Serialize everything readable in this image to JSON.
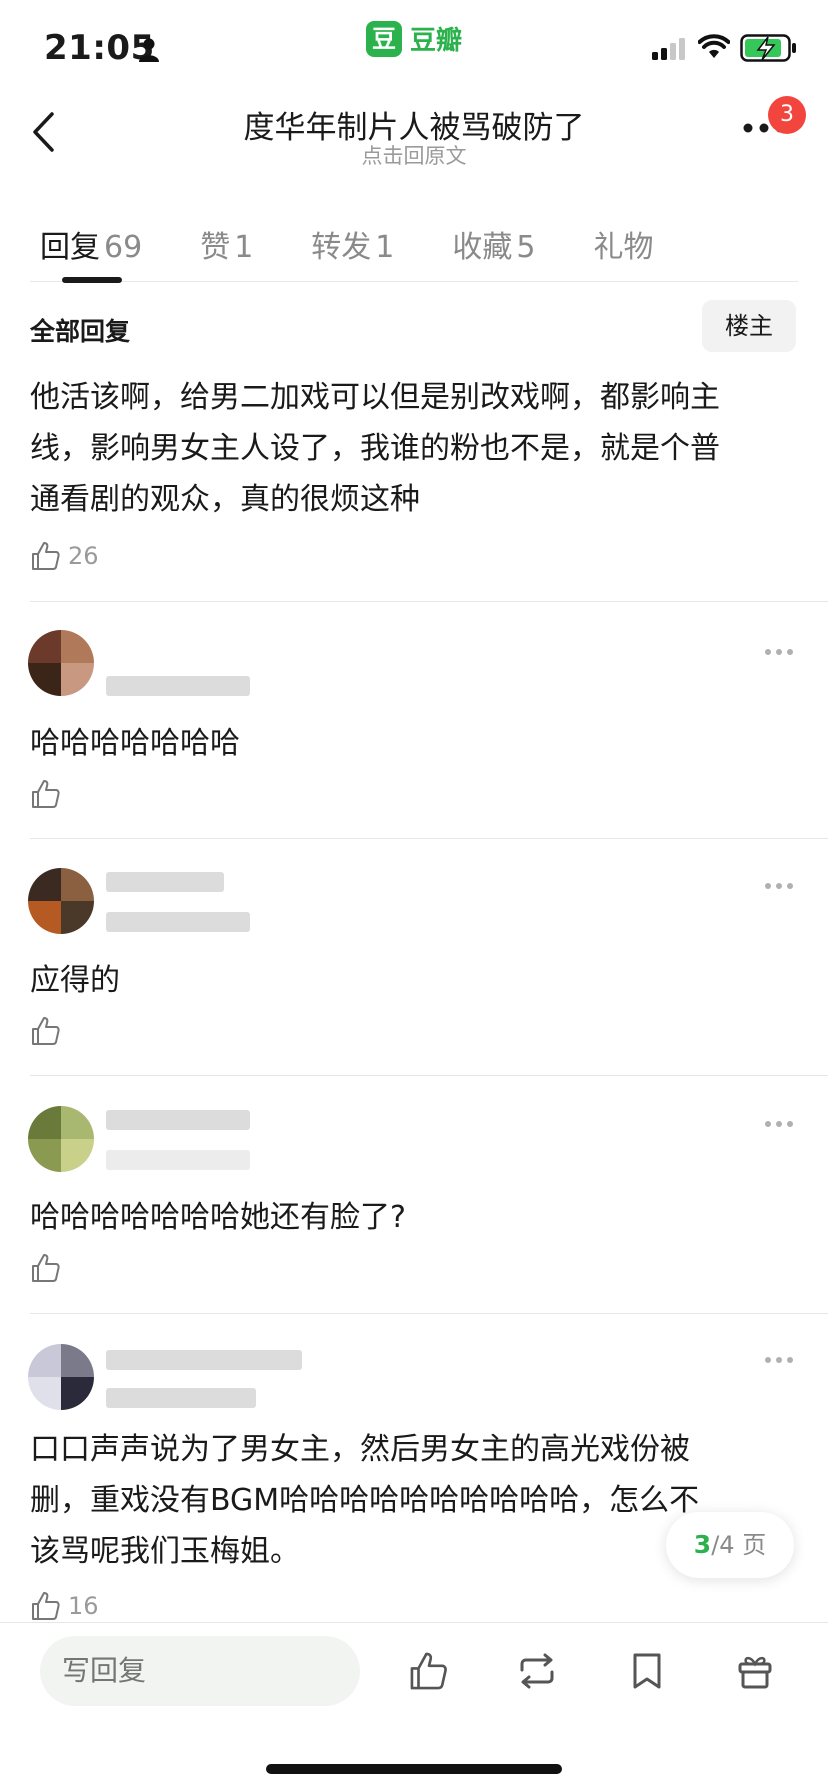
{
  "status_bar": {
    "time": "21:05",
    "app_name": "豆瓣",
    "app_logo_char": "豆"
  },
  "nav": {
    "title": "度华年制片人被骂破防了",
    "subtitle": "点击回原文",
    "notification_badge": "3"
  },
  "tabs": [
    {
      "label": "回复",
      "count": "69",
      "active": true
    },
    {
      "label": "赞",
      "count": "1",
      "active": false
    },
    {
      "label": "转发",
      "count": "1",
      "active": false
    },
    {
      "label": "收藏",
      "count": "5",
      "active": false
    },
    {
      "label": "礼物",
      "count": "",
      "active": false
    }
  ],
  "section": {
    "label": "全部回复",
    "op_button": "楼主"
  },
  "op_post": {
    "lines": [
      "他活该啊，给男二加戏可以但是别改戏啊，都影响主",
      "线，影响男女主人设了，我谁的粉也不是，就是个普",
      "通看剧的观众，真的很烦这种"
    ],
    "likes": "26"
  },
  "replies": [
    {
      "text": "哈哈哈哈哈哈哈",
      "likes": ""
    },
    {
      "text": "应得的",
      "likes": ""
    },
    {
      "text": "哈哈哈哈哈哈哈她还有脸了?",
      "likes": ""
    },
    {
      "lines": [
        "口口声声说为了男女主，然后男女主的高光戏份被",
        "删，重戏没有BGM哈哈哈哈哈哈哈哈哈哈，怎么不",
        "该骂呢我们玉梅姐。"
      ],
      "likes": "16"
    }
  ],
  "pagination": {
    "current": "3",
    "total_label": "/4 页"
  },
  "bottom_bar": {
    "reply_placeholder": "写回复"
  },
  "colors": {
    "accent_green": "#2bb24c",
    "badge_red": "#f2453d",
    "muted_gray": "#9a9a9a"
  }
}
